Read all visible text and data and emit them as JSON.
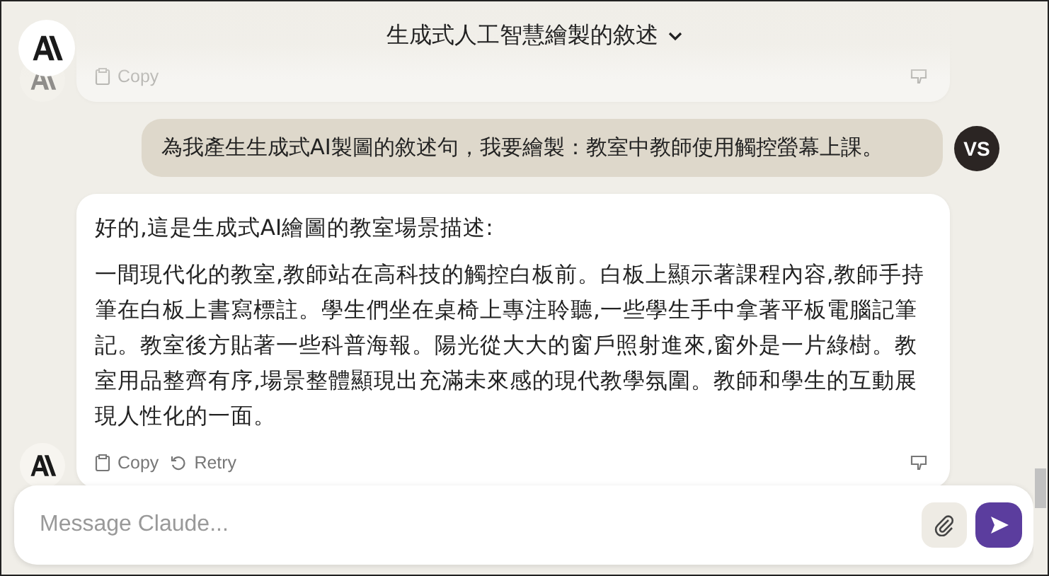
{
  "header": {
    "title": "生成式人工智慧繪製的敘述",
    "menu_open": false
  },
  "messages": [
    {
      "kind": "assistant",
      "faded": true,
      "actions": [
        "Copy"
      ]
    },
    {
      "kind": "user",
      "avatar": "VS",
      "text": "為我產生生成式AI製圖的敘述句，我要繪製：教室中教師使用觸控螢幕上課。"
    },
    {
      "kind": "assistant",
      "faded": false,
      "paragraphs": [
        "好的,這是生成式AI繪圖的教室場景描述:",
        "一間現代化的教室,教師站在高科技的觸控白板前。白板上顯示著課程內容,教師手持筆在白板上書寫標註。學生們坐在桌椅上專注聆聽,一些學生手中拿著平板電腦記筆記。教室後方貼著一些科普海報。陽光從大大的窗戶照射進來,窗外是一片綠樹。教室用品整齊有序,場景整體顯現出充滿未來感的現代教學氛圍。教師和學生的互動展現人性化的一面。"
      ],
      "actions": [
        "Copy",
        "Retry"
      ]
    }
  ],
  "composer": {
    "placeholder": "Message Claude..."
  }
}
